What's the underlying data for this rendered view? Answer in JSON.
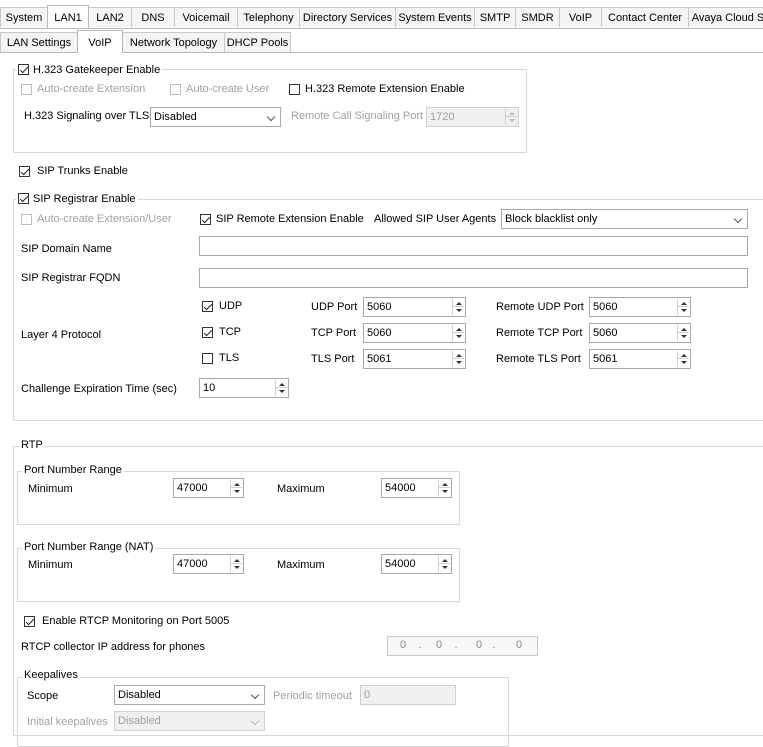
{
  "tabs_top": [
    "System",
    "LAN1",
    "LAN2",
    "DNS",
    "Voicemail",
    "Telephony",
    "Directory Services",
    "System Events",
    "SMTP",
    "SMDR",
    "VoIP",
    "Contact Center",
    "Avaya Cloud S"
  ],
  "tabs_sub": [
    "LAN Settings",
    "VoIP",
    "Network Topology",
    "DHCP Pools"
  ],
  "h323": {
    "gatekeeper_enable": "H.323 Gatekeeper Enable",
    "auto_create_extension": "Auto-create Extension",
    "auto_create_user": "Auto-create User",
    "remote_extension_enable": "H.323 Remote Extension Enable",
    "signaling_tls_label": "H.323 Signaling over TLS",
    "signaling_tls_value": "Disabled",
    "remote_port_label": "Remote Call Signaling Port",
    "remote_port_value": "1720"
  },
  "sip": {
    "trunks_enable": "SIP Trunks Enable",
    "registrar_enable": "SIP Registrar Enable",
    "auto_create_ext_user": "Auto-create Extension/User",
    "remote_extension_enable": "SIP Remote Extension Enable",
    "allowed_agents_label": "Allowed SIP User Agents",
    "allowed_agents_value": "Block blacklist only",
    "domain_name_label": "SIP Domain Name",
    "domain_name_value": "",
    "registrar_fqdn_label": "SIP Registrar FQDN",
    "registrar_fqdn_value": "",
    "layer4_label": "Layer 4 Protocol",
    "udp": "UDP",
    "tcp": "TCP",
    "tls": "TLS",
    "udp_port_label": "UDP Port",
    "udp_port_value": "5060",
    "tcp_port_label": "TCP Port",
    "tcp_port_value": "5060",
    "tls_port_label": "TLS Port",
    "tls_port_value": "5061",
    "remote_udp_label": "Remote UDP Port",
    "remote_udp_value": "5060",
    "remote_tcp_label": "Remote TCP Port",
    "remote_tcp_value": "5060",
    "remote_tls_label": "Remote TLS Port",
    "remote_tls_value": "5061",
    "challenge_label": "Challenge Expiration Time (sec)",
    "challenge_value": "10"
  },
  "rtp": {
    "legend": "RTP",
    "port_range_legend": "Port Number Range",
    "port_range_nat_legend": "Port Number Range (NAT)",
    "minimum_label": "Minimum",
    "maximum_label": "Maximum",
    "min_value": "47000",
    "max_value": "54000",
    "nat_min_value": "47000",
    "nat_max_value": "54000",
    "rtcp_enable": "Enable RTCP Monitoring on Port 5005",
    "rtcp_collector_label": "RTCP collector IP address for phones",
    "ip": [
      "0",
      "0",
      "0",
      "0"
    ],
    "keepalives_legend": "Keepalives",
    "scope_label": "Scope",
    "scope_value": "Disabled",
    "periodic_label": "Periodic timeout",
    "periodic_value": "0",
    "initial_label": "Initial keepalives",
    "initial_value": "Disabled"
  }
}
